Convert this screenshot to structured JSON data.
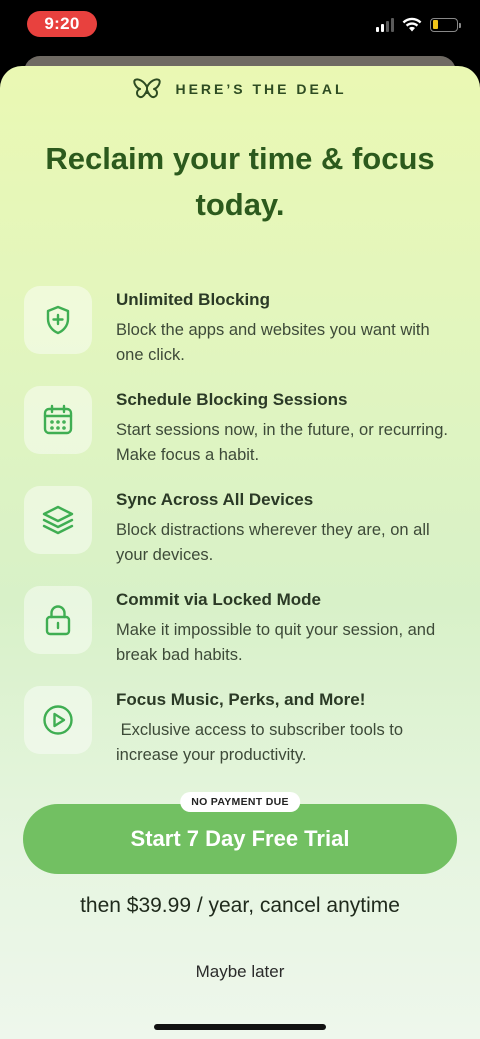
{
  "status_bar": {
    "time": "9:20",
    "icons": [
      "cellular-signal-icon",
      "wifi-icon",
      "battery-low-icon"
    ],
    "colors": {
      "time_pill": "#e8413e",
      "battery_fill": "#f0c419"
    }
  },
  "sheet": {
    "header_label": "HERE’S THE DEAL",
    "logo_icon": "butterfly-icon",
    "headline": "Reclaim your time & focus today.",
    "features": [
      {
        "icon": "shield-plus-icon",
        "title": "Unlimited Blocking",
        "description": "Block the apps and websites you want with one click."
      },
      {
        "icon": "calendar-icon",
        "title": "Schedule Blocking Sessions",
        "description": "Start sessions now, in the future, or recurring. Make focus a habit."
      },
      {
        "icon": "layers-icon",
        "title": "Sync Across All Devices",
        "description": "Block distractions wherever they are, on all your devices."
      },
      {
        "icon": "lock-icon",
        "title": "Commit via Locked Mode",
        "description": "Make it impossible to quit your session, and break bad habits."
      },
      {
        "icon": "play-circle-icon",
        "title": "Focus Music, Perks, and More!",
        "description": " Exclusive access to subscriber tools to increase your productivity."
      }
    ],
    "badge": "NO PAYMENT DUE",
    "cta_label": "Start 7 Day Free Trial",
    "price_text": "then $39.99 / year, cancel anytime",
    "dismiss_label": "Maybe later",
    "colors": {
      "accent": "#72c062",
      "icon_green": "#3fae52",
      "headline": "#2c5a1d"
    }
  }
}
